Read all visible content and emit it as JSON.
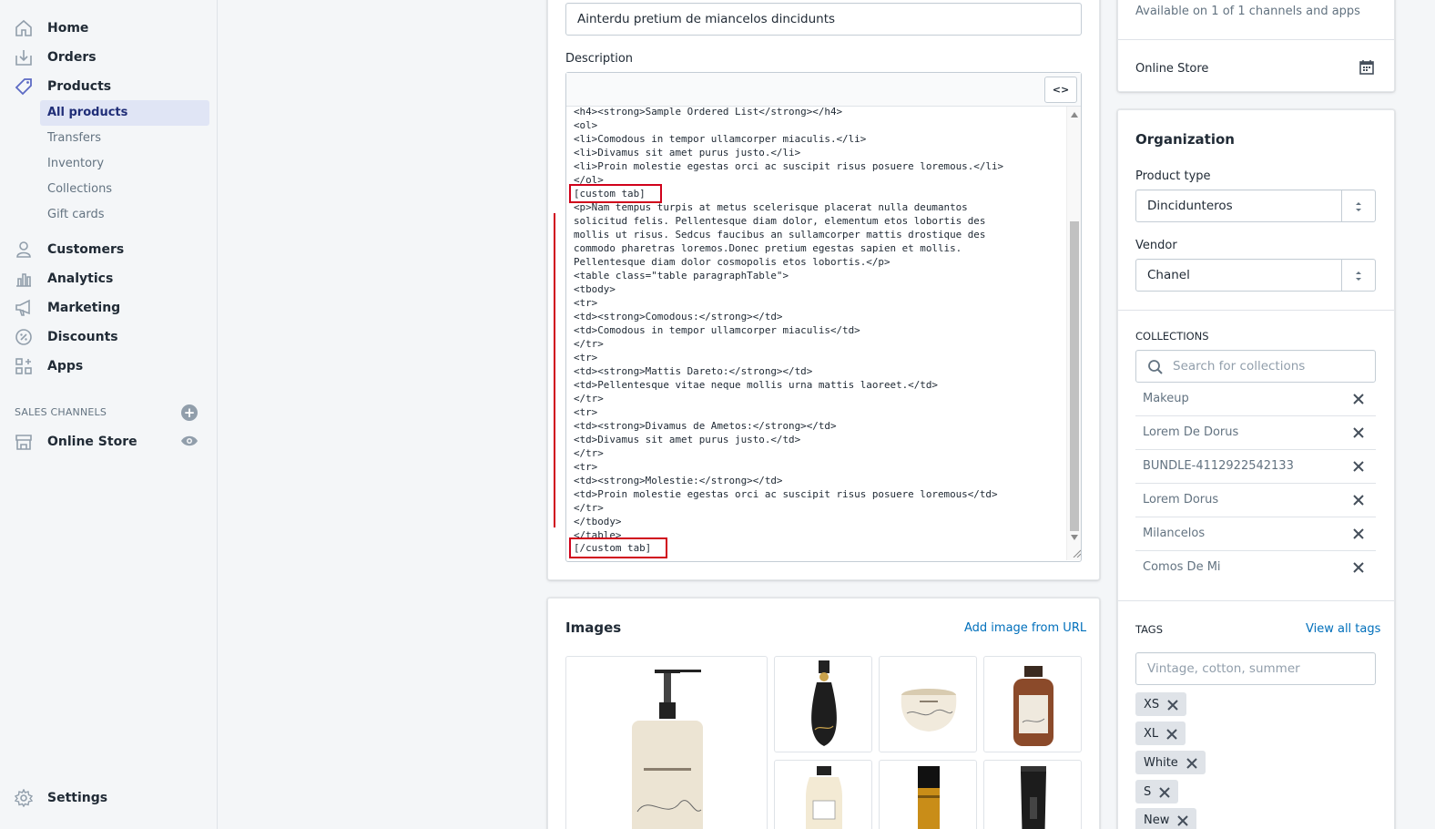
{
  "sidebar": {
    "items": [
      {
        "label": "Home",
        "icon": "home-icon"
      },
      {
        "label": "Orders",
        "icon": "orders-icon"
      },
      {
        "label": "Products",
        "icon": "tag-icon"
      },
      {
        "label": "Customers",
        "icon": "customer-icon"
      },
      {
        "label": "Analytics",
        "icon": "analytics-icon"
      },
      {
        "label": "Marketing",
        "icon": "megaphone-icon"
      },
      {
        "label": "Discounts",
        "icon": "discount-icon"
      },
      {
        "label": "Apps",
        "icon": "apps-icon"
      }
    ],
    "sub_items": [
      "All products",
      "Transfers",
      "Inventory",
      "Collections",
      "Gift cards"
    ],
    "sales_channels_title": "SALES CHANNELS",
    "online_store": "Online Store",
    "settings": "Settings"
  },
  "product": {
    "title_value": "Ainterdu pretium de miancelos dincidunts",
    "description_label": "Description",
    "html_toggle": "<>",
    "code_lines": [
      "<h4><strong>Sample Ordered List</strong></h4>",
      "<ol>",
      "<li>Comodous in tempor ullamcorper miaculis.</li>",
      "<li>Divamus sit amet purus justo.</li>",
      "<li>Proin molestie egestas orci ac suscipit risus posuere loremous.</li>",
      "</ol>",
      "[custom tab]",
      "<p>Nam tempus turpis at metus scelerisque placerat nulla deumantos",
      "solicitud felis. Pellentesque diam dolor, elementum etos lobortis des",
      "mollis ut risus. Sedcus faucibus an sullamcorper mattis drostique des",
      "commodo pharetras loremos.Donec pretium egestas sapien et mollis.",
      "Pellentesque diam dolor cosmopolis etos lobortis.</p>",
      "<table class=\"table paragraphTable\">",
      "<tbody>",
      "<tr>",
      "<td><strong>Comodous:</strong></td>",
      "<td>Comodous in tempor ullamcorper miaculis</td>",
      "</tr>",
      "<tr>",
      "<td><strong>Mattis Dareto:</strong></td>",
      "<td>Pellentesque vitae neque mollis urna mattis laoreet.</td>",
      "</tr>",
      "<tr>",
      "<td><strong>Divamus de Ametos:</strong></td>",
      "<td>Divamus sit amet purus justo.</td>",
      "</tr>",
      "<tr>",
      "<td><strong>Molestie:</strong></td>",
      "<td>Proin molestie egestas orci ac suscipit risus posuere loremous</td>",
      "</tr>",
      "</tbody>",
      "</table>",
      "[/custom tab]"
    ]
  },
  "images": {
    "title": "Images",
    "add_from_url": "Add image from URL",
    "tiles": [
      "pump-bottle-image",
      "black-vase-bottle-image",
      "cream-jar-image",
      "amber-bottle-image",
      "cream-bottle-image",
      "gold-tube-image",
      "black-tube-image"
    ]
  },
  "availability": {
    "text": "Available on 1 of 1 channels and apps",
    "channel": "Online Store"
  },
  "organization": {
    "title": "Organization",
    "product_type_label": "Product type",
    "product_type_value": "Dincidunteros",
    "vendor_label": "Vendor",
    "vendor_value": "Chanel",
    "collections_title": "COLLECTIONS",
    "collections_placeholder": "Search for collections",
    "collections": [
      "Makeup",
      "Lorem De Dorus",
      "BUNDLE-4112922542133",
      "Lorem Dorus",
      "Milancelos",
      "Comos De Mi"
    ],
    "tags_title": "TAGS",
    "view_all_tags": "View all tags",
    "tags_placeholder": "Vintage, cotton, summer",
    "tags": [
      "XS",
      "XL",
      "White",
      "S",
      "New"
    ]
  },
  "colors": {
    "accent": "#5c6ac4",
    "highlight": "#d0021b",
    "link": "#006fbb"
  }
}
